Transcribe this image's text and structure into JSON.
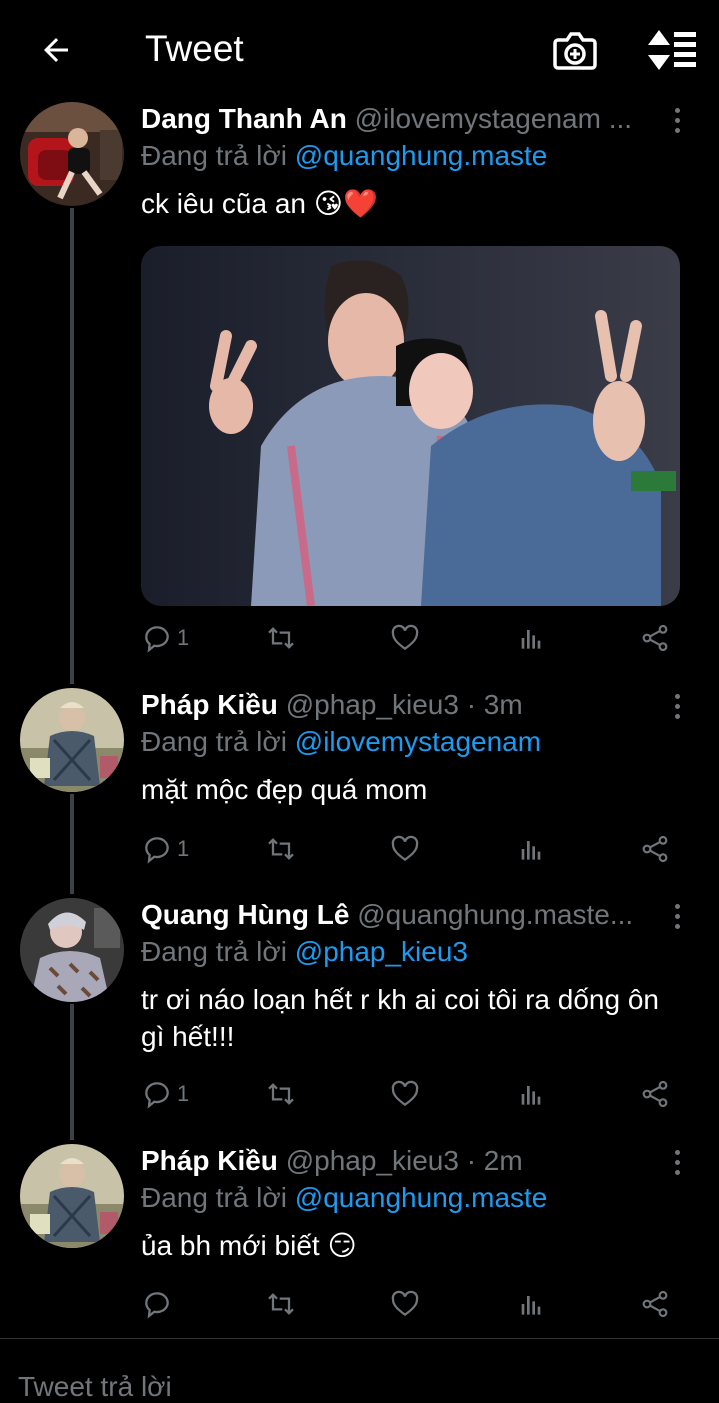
{
  "header": {
    "title": "Tweet"
  },
  "tweets": [
    {
      "name": "Dang Thanh An",
      "handle": "@ilovemystagenam ...",
      "replying_prefix": "Đang trả lời ",
      "replying_to": "@quanghung.maste",
      "text": "ck iêu cũa an 😘❤️",
      "reply_count": "1"
    },
    {
      "name": "Pháp Kiều",
      "handle": "@phap_kieu3 · 3m",
      "replying_prefix": "Đang trả lời ",
      "replying_to": "@ilovemystagenam",
      "text": "mặt mộc đẹp quá mom",
      "reply_count": "1"
    },
    {
      "name": "Quang Hùng Lê",
      "handle": "@quanghung.maste...",
      "replying_prefix": "Đang trả lời ",
      "replying_to": "@phap_kieu3",
      "text": "tr ơi náo loạn hết r kh ai coi tôi ra dống ôn gì hết!!!",
      "reply_count": "1"
    },
    {
      "name": "Pháp Kiều",
      "handle": "@phap_kieu3 · 2m",
      "replying_prefix": "Đang trả lời ",
      "replying_to": "@quanghung.maste",
      "text": "ủa bh mới biết 😏",
      "reply_count": ""
    }
  ],
  "reply_bar": {
    "placeholder": "Tweet trả lời"
  },
  "colors": {
    "background": "#000000",
    "accent": "#1d9bf0",
    "muted": "#71767b"
  }
}
